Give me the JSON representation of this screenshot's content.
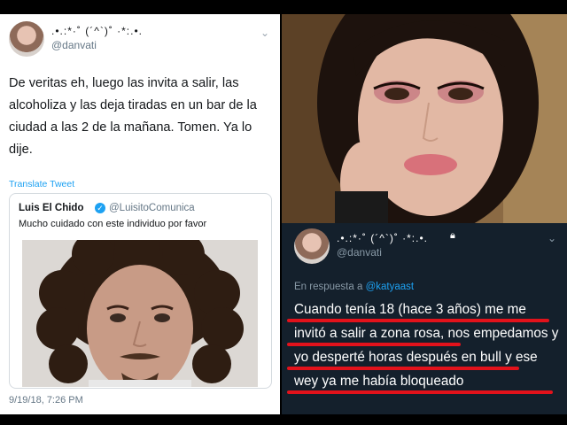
{
  "left_tweet": {
    "display_name": ".•.:*·˚ (´^`)˚ ·*:.•.",
    "handle": "@danvati",
    "text": "De veritas eh, luego las invita a salir, las alcoholiza y las deja tiradas en un bar de la ciudad a las 2 de la mañana. Tomen. Ya lo dije.",
    "translate_label": "Translate Tweet",
    "timestamp": "9/19/18, 7:26 PM",
    "quoted": {
      "name": "Luis El Chido",
      "handle": "@LuisitoComunica",
      "text": "Mucho cuidado con este individuo por favor"
    }
  },
  "right_tweet": {
    "display_name": ".•.:*·˚ (´^`)˚ ·*:.•.",
    "handle": "@danvati",
    "reply_prefix": "En respuesta a",
    "reply_mention": "@katyaast",
    "text": "Cuando tenía 18 (hace 3 años) me me invitó a salir a zona rosa, nos empedamos y yo desperté horas después en bull y ese wey ya me había bloqueado"
  },
  "icons": {
    "verified": "verified-icon",
    "chevron": "chevron-down-icon",
    "lock": "lock-icon"
  },
  "colors": {
    "twitter_blue": "#1da1f2",
    "highlight_red": "#e2121b",
    "dark_bg": "#14202c"
  }
}
